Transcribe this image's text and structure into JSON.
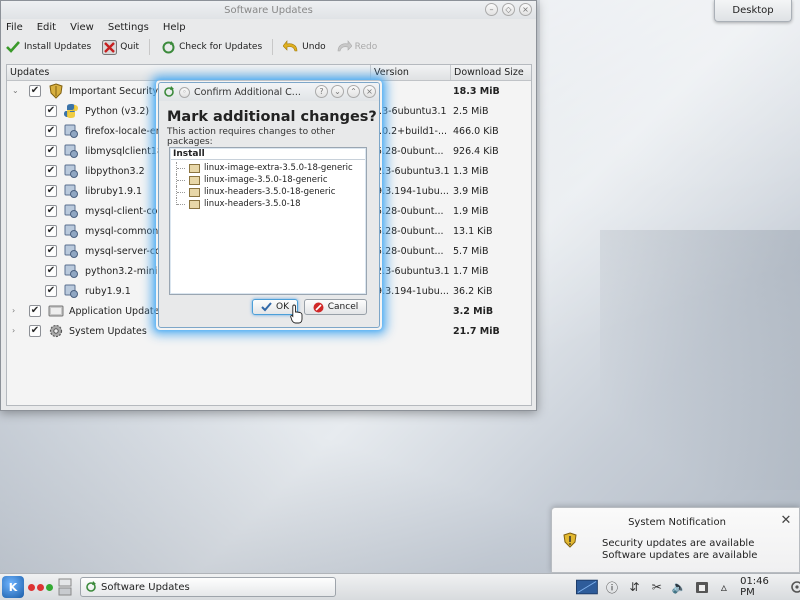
{
  "desktop": {
    "button_label": "Desktop"
  },
  "window": {
    "title": "Software Updates",
    "menu": [
      "File",
      "Edit",
      "View",
      "Settings",
      "Help"
    ],
    "toolbar": {
      "install": "Install Updates",
      "quit": "Quit",
      "check": "Check for Updates",
      "undo": "Undo",
      "redo": "Redo"
    },
    "columns": {
      "updates": "Updates",
      "version": "Version",
      "size": "Download Size"
    },
    "groups": [
      {
        "name": "Important Security U",
        "size": "18.3 MiB"
      },
      {
        "name": "Application Updates",
        "size": "3.2 MiB"
      },
      {
        "name": "System Updates",
        "size": "21.7 MiB"
      }
    ],
    "packages": [
      {
        "name": "Python (v3.2)",
        "version": "2.3-6ubuntu3.1",
        "size": "2.5 MiB"
      },
      {
        "name": "firefox-locale-en",
        "version": "6.0.2+build1-...",
        "size": "466.0 KiB"
      },
      {
        "name": "libmysqlclient18",
        "version": ".5.28-0ubunt...",
        "size": "926.4 KiB"
      },
      {
        "name": "libpython3.2",
        "version": ".2.3-6ubuntu3.1",
        "size": "1.3 MiB"
      },
      {
        "name": "libruby1.9.1",
        "version": ".9.3.194-1ubu...",
        "size": "3.9 MiB"
      },
      {
        "name": "mysql-client-core",
        "version": ".5.28-0ubunt...",
        "size": "1.9 MiB"
      },
      {
        "name": "mysql-common",
        "version": ".5.28-0ubunt...",
        "size": "13.1 KiB"
      },
      {
        "name": "mysql-server-core",
        "version": ".5.28-0ubunt...",
        "size": "5.7 MiB"
      },
      {
        "name": "python3.2-minimal",
        "version": ".2.3-6ubuntu3.1",
        "size": "1.7 MiB"
      },
      {
        "name": "ruby1.9.1",
        "version": ".9.3.194-1ubu...",
        "size": "36.2 KiB"
      }
    ]
  },
  "dialog": {
    "title": "Confirm Additional C...",
    "heading": "Mark additional changes?",
    "subtext": "This action requires changes to other packages:",
    "list_header": "Install",
    "items": [
      "linux-image-extra-3.5.0-18-generic",
      "linux-image-3.5.0-18-generic",
      "linux-headers-3.5.0-18-generic",
      "linux-headers-3.5.0-18"
    ],
    "ok": "OK",
    "cancel": "Cancel"
  },
  "notification": {
    "title": "System Notification",
    "line1": "Security updates are available",
    "line2": "Software updates are available"
  },
  "taskbar": {
    "task": "Software Updates",
    "clock": "01:46 PM"
  }
}
